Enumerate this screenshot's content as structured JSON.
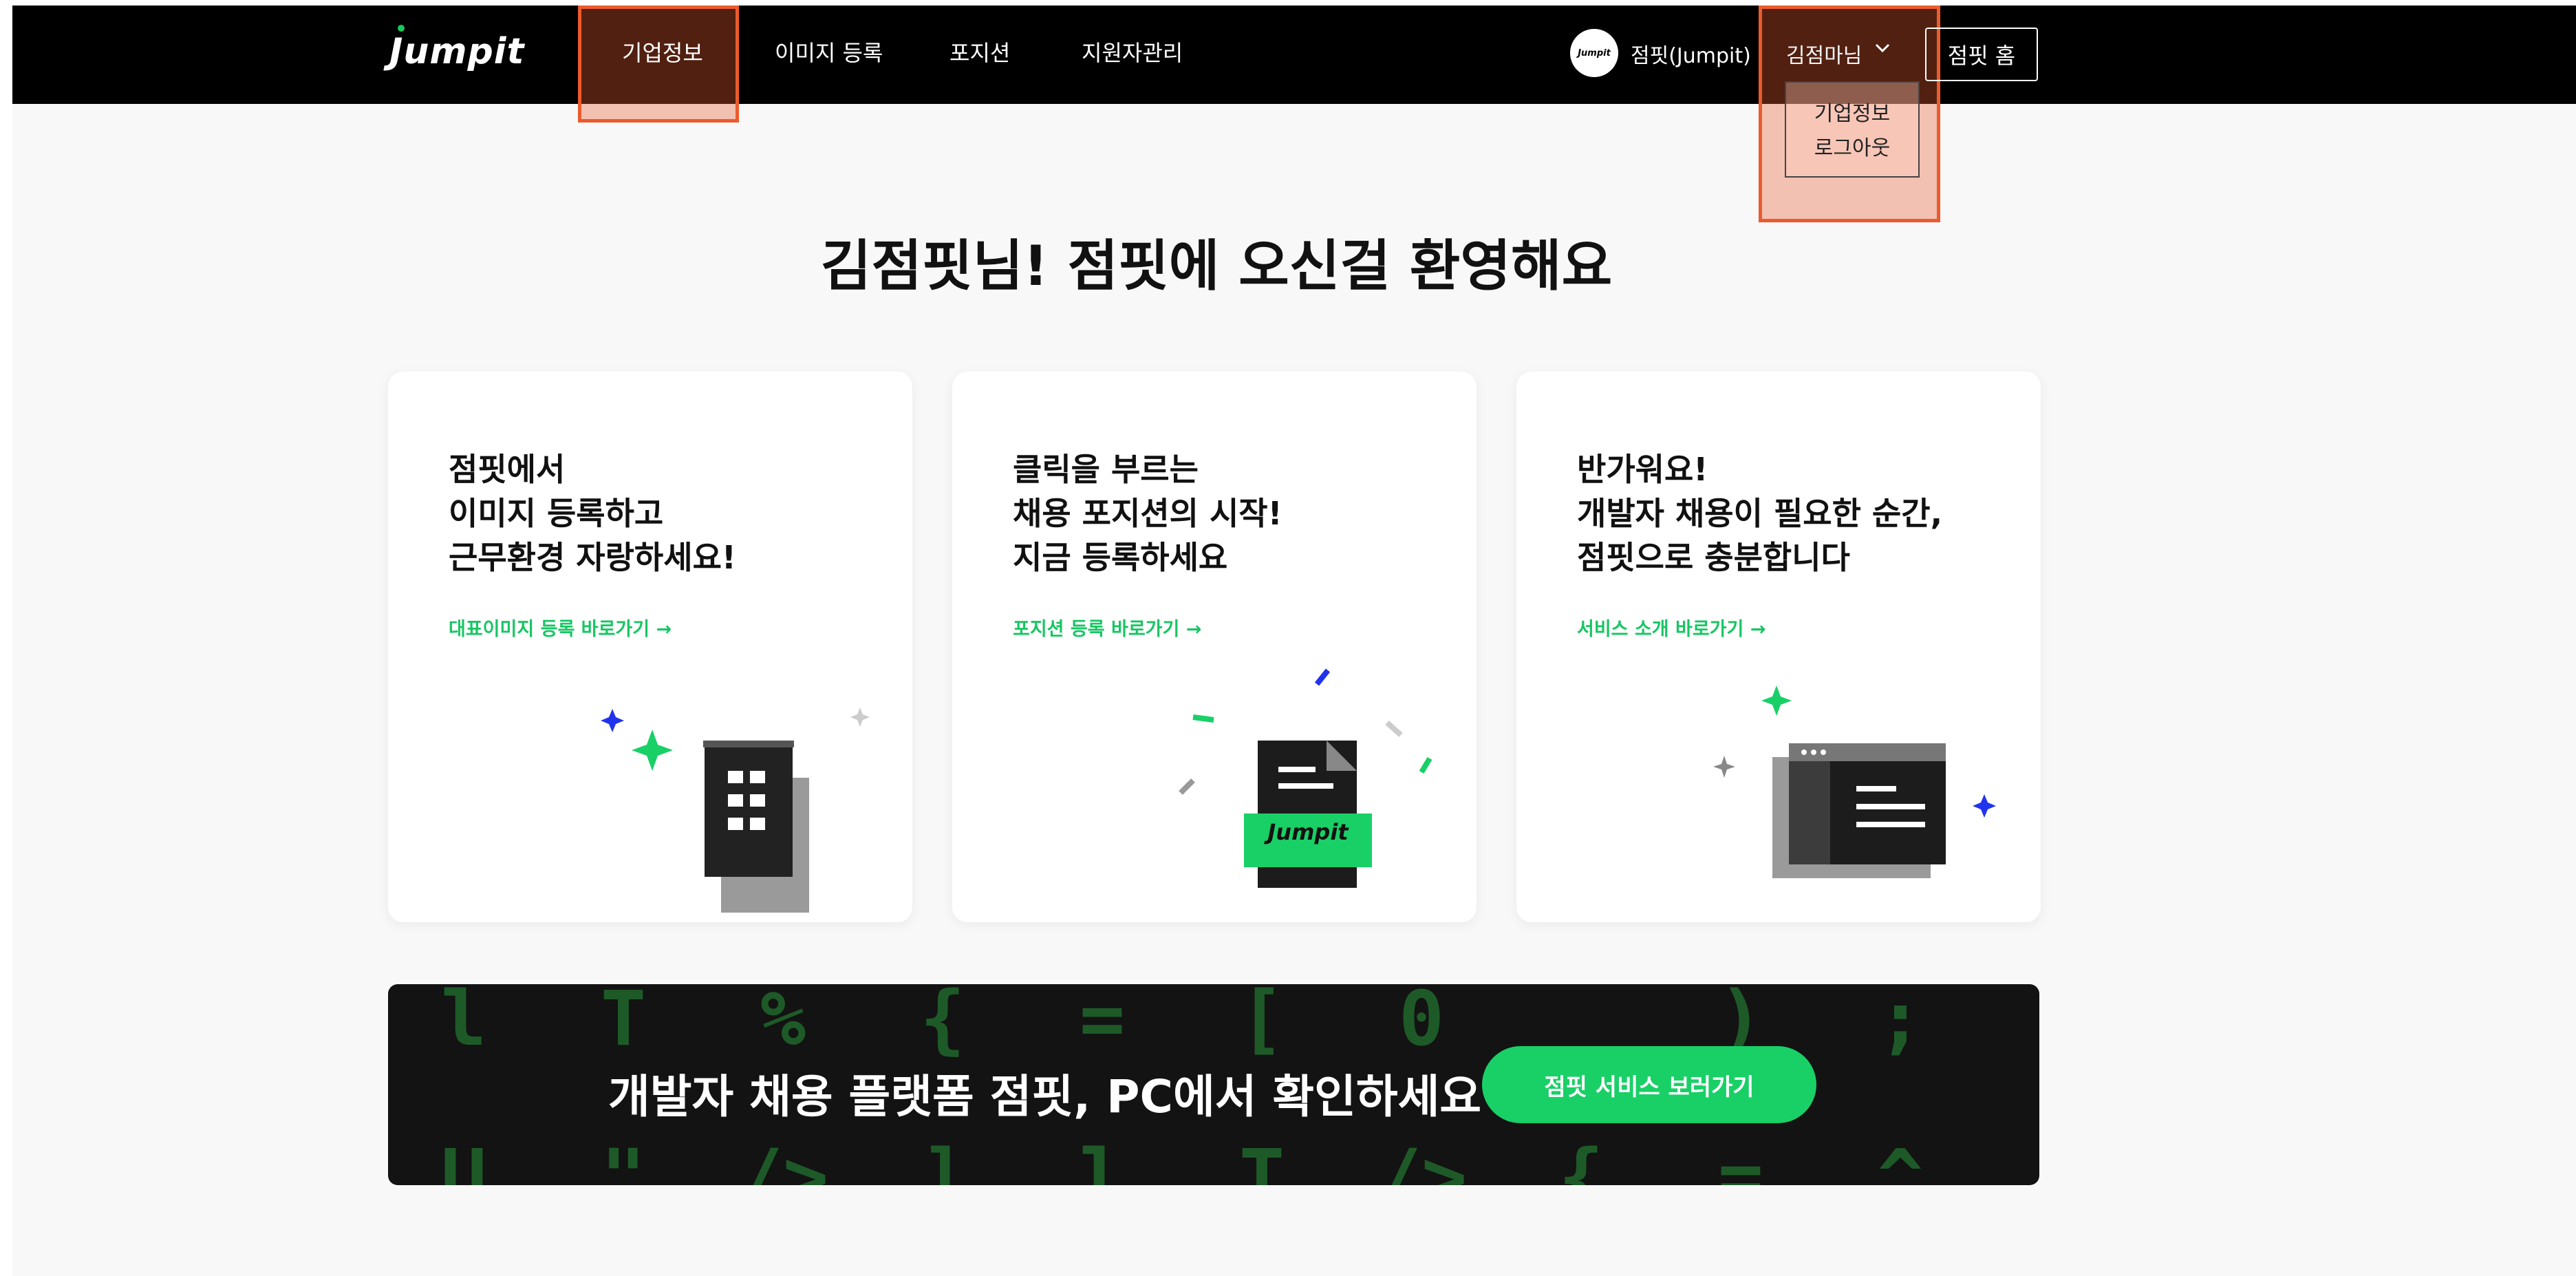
{
  "nav": {
    "logo": "Jumpit",
    "items": [
      "기업정보",
      "이미지 등록",
      "포지션",
      "지원자관리"
    ],
    "company_avatar": "Jumpit",
    "company_name": "점핏(Jumpit)",
    "user_name": "김점마님",
    "dropdown": [
      "기업정보",
      "로그아웃"
    ],
    "home_button": "점핏 홈"
  },
  "welcome": "김점핏님! 점핏에 오신걸 환영해요",
  "cards": [
    {
      "title": [
        "점핏에서",
        "이미지 등록하고",
        "근무환경 자랑하세요!"
      ],
      "link": "대표이미지 등록 바로가기 →",
      "illus_icon": "building-icon"
    },
    {
      "title": [
        "클릭을 부르는",
        "채용 포지션의 시작!",
        "지금 등록하세요"
      ],
      "link": "포지션 등록 바로가기 →",
      "illus_icon": "document-icon",
      "illus_label": "Jumpit"
    },
    {
      "title": [
        "반가워요!",
        "개발자 채용이 필요한 순간,",
        "점핏으로 충분합니다"
      ],
      "link": "서비스 소개 바로가기 →",
      "illus_icon": "browser-window-icon"
    }
  ],
  "banner": {
    "text": "개발자 채용 플랫폼 점핏, PC에서 확인하세요",
    "button": "점핏 서비스 보러가기",
    "bg_symbols_top": [
      "l",
      "T",
      "%",
      "{",
      "=",
      "[",
      "0",
      "_",
      ")",
      ";"
    ],
    "bg_symbols_bottom": [
      "U",
      "\"",
      "/>",
      "]",
      "l",
      "T",
      "/>",
      "{",
      "=",
      "^"
    ]
  },
  "colors": {
    "accent_green": "#19d067",
    "highlight_orange": "#ec5b2d",
    "nav_bg": "#000000",
    "banner_bg": "#131313",
    "sparkle_blue": "#2233ee"
  }
}
